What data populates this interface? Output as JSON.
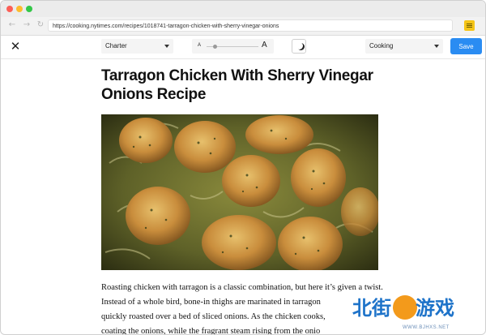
{
  "browser": {
    "url": "https://cooking.nytimes.com/recipes/1018741-tarragon-chicken-with-sherry-vinegar-onions",
    "back_icon": "arrow-left-icon",
    "forward_icon": "arrow-right-icon",
    "reload_icon": "reload-icon",
    "extension_icon": "notes-extension-icon"
  },
  "reader": {
    "close_icon": "close-icon",
    "font_select": {
      "selected": "Charter"
    },
    "text_size": {
      "small_label": "A",
      "large_label": "A",
      "level": 0.17
    },
    "theme_icon": "moon-icon",
    "mode_select": {
      "selected": "Cooking"
    },
    "save_label": "Save",
    "accent_color": "#2a8cf2"
  },
  "article": {
    "title": "Tarragon Chicken With Sherry Vinegar Onions Recipe",
    "body_lines": [
      "Roasting chicken with tarragon is a classic combination, but here it’s given a twist.",
      "Instead of a whole bird, bone-in thighs are marinated in tarragon",
      "quickly roasted over a bed of sliced onions. As the chicken cooks,",
      "coating the onions, while the fragrant steam rising from the onio"
    ]
  },
  "watermark": {
    "text_left": "北街",
    "text_right": "游戏",
    "url": "WWW.BJHXS.NET"
  }
}
